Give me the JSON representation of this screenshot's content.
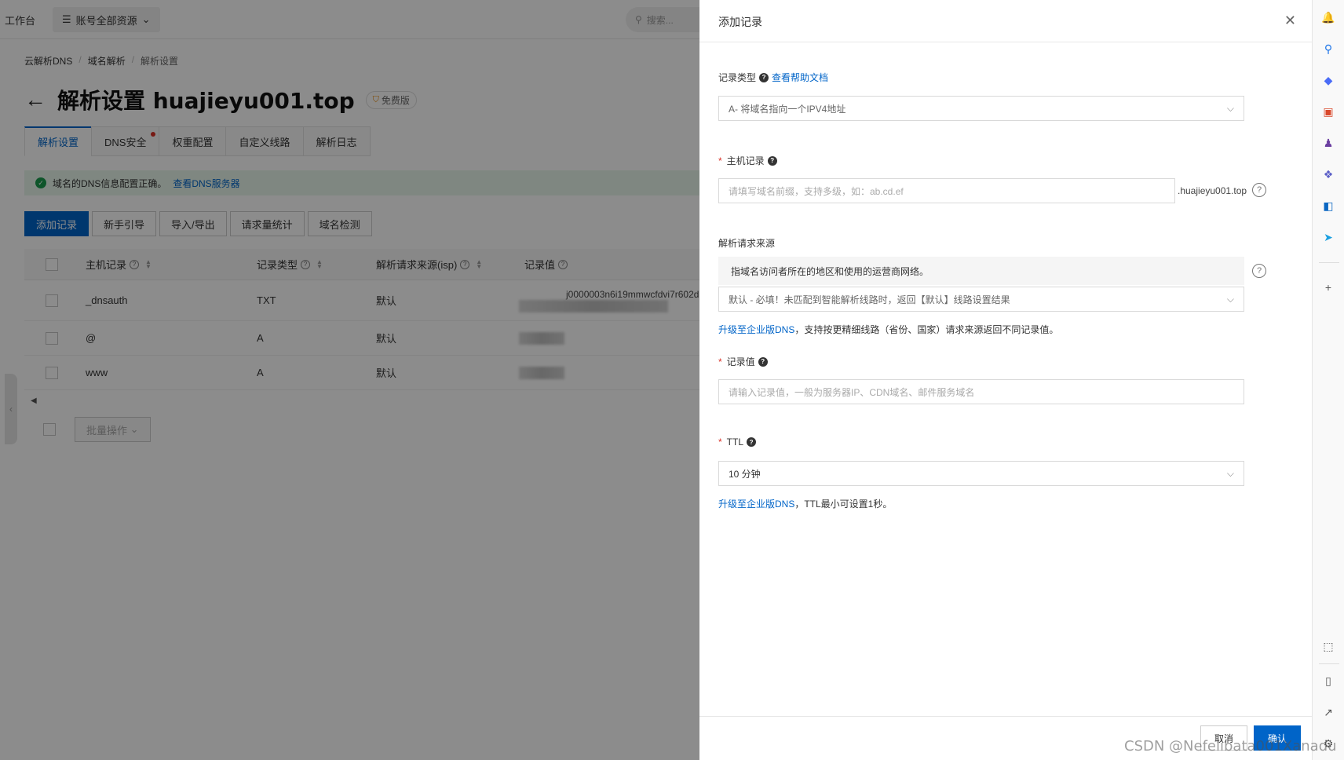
{
  "topbar": {
    "workbench": "工作台",
    "resource": "账号全部资源",
    "search_placeholder": "搜索..."
  },
  "breadcrumb": {
    "root": "云解析DNS",
    "mid": "域名解析",
    "current": "解析设置"
  },
  "page": {
    "title": "解析设置 huajieyu001.top",
    "badge": "免费版"
  },
  "tabs": [
    {
      "label": "解析设置"
    },
    {
      "label": "DNS安全"
    },
    {
      "label": "权重配置"
    },
    {
      "label": "自定义线路"
    },
    {
      "label": "解析日志"
    }
  ],
  "alert": {
    "text": "域名的DNS信息配置正确。",
    "link": "查看DNS服务器"
  },
  "actions": {
    "add": "添加记录",
    "guide": "新手引导",
    "import_export": "导入/导出",
    "stats": "请求量统计",
    "check": "域名检测"
  },
  "table": {
    "headers": {
      "host": "主机记录",
      "type": "记录类型",
      "isp": "解析请求来源(isp)",
      "value": "记录值"
    },
    "rows": [
      {
        "host": "_dnsauth",
        "type": "TXT",
        "isp": "默认",
        "value": "j0000003n6i19mmwcfdvi7r602d"
      },
      {
        "host": "@",
        "type": "A",
        "isp": "默认",
        "value": ""
      },
      {
        "host": "www",
        "type": "A",
        "isp": "默认",
        "value": ""
      }
    ],
    "bulk": "批量操作"
  },
  "drawer": {
    "title": "添加记录",
    "record_type": {
      "label": "记录类型",
      "help_link": "查看帮助文档",
      "value": "A- 将域名指向一个IPV4地址"
    },
    "host": {
      "label": "主机记录",
      "placeholder": "请填写域名前缀，支持多级，如：ab.cd.ef",
      "suffix": ".huajieyu001.top"
    },
    "source": {
      "label": "解析请求来源",
      "desc": "指域名访问者所在的地区和使用的运营商网络。",
      "value": "默认 - 必填！未匹配到智能解析线路时，返回【默认】线路设置结果",
      "upgrade_link": "升级至企业版DNS",
      "upgrade_note": "，支持按更精细线路（省份、国家）请求来源返回不同记录值。"
    },
    "value": {
      "label": "记录值",
      "placeholder": "请输入记录值，一般为服务器IP、CDN域名、邮件服务域名"
    },
    "ttl": {
      "label": "TTL",
      "value": "10 分钟",
      "upgrade_link": "升级至企业版DNS",
      "upgrade_note": "，TTL最小可设置1秒。"
    },
    "cancel": "取消",
    "confirm": "确认"
  },
  "watermark": "CSDN @Nefelibata001Xanadu",
  "colors": {
    "primary": "#0064c8",
    "required": "#d93026",
    "success": "#1a9c4e"
  }
}
